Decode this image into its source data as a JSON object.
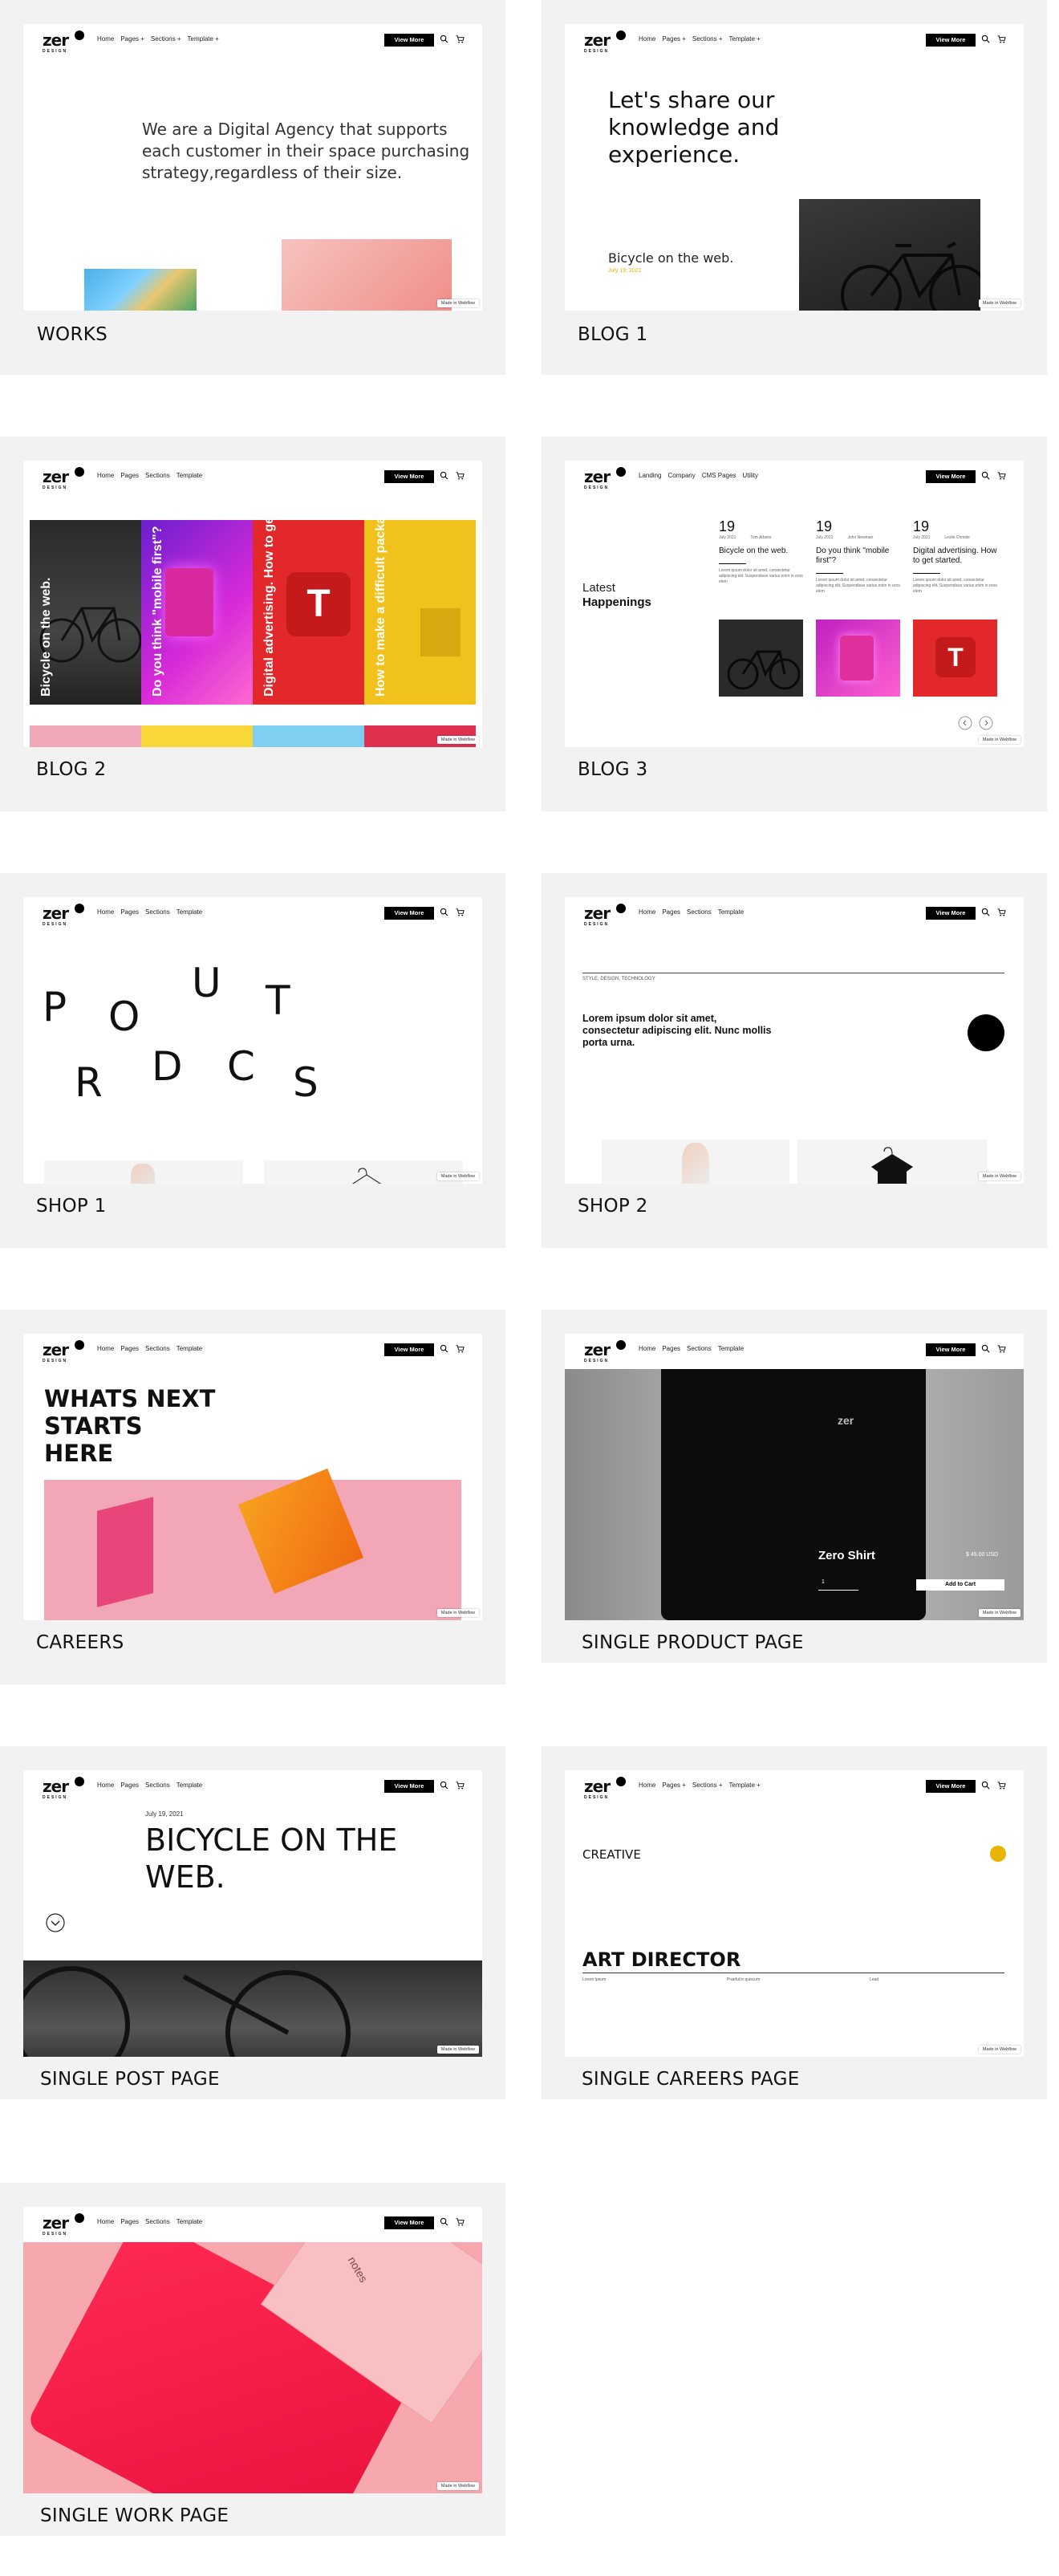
{
  "colors": {
    "card_bg": "#f2f2f2",
    "accent_yellow": "#e8b400",
    "brand_black": "#000000"
  },
  "nav": {
    "logo_text": "zer",
    "logo_sub": "DESIGN",
    "cta": "View More",
    "links_a": [
      "Home",
      "Pages +",
      "Sections +",
      "Template +"
    ],
    "links_b": [
      "Home",
      "Pages",
      "Sections",
      "Template"
    ],
    "links_c": [
      "Landing",
      "Company",
      "CMS Pages",
      "Utility"
    ],
    "links_d": [
      "Home",
      "Pages",
      "Sections +",
      "Template"
    ],
    "links_e": [
      "Home",
      "Pages +",
      "Sections +",
      "Template +"
    ],
    "search_icon": "search-icon",
    "cart_icon": "cart-icon"
  },
  "badge": "Made in Webflow",
  "cards": [
    {
      "label": "WORKS",
      "headline": "We are a Digital Agency that supports each customer in their space purchasing strategy,regardless of their size."
    },
    {
      "label": "BLOG 1",
      "headline": "Let's share our knowledge and experience.",
      "post_title": "Bicycle on the web.",
      "post_date": "July 19, 2021"
    },
    {
      "label": "BLOG 2",
      "tiles": [
        "Bicycle on the web.",
        "Do you think \"mobile first\"?",
        "Digital advertising. How to get started.",
        "How to make a difficult packaging."
      ]
    },
    {
      "label": "BLOG 3",
      "latest": "Latest",
      "happenings": "Happenings",
      "posts": [
        {
          "day": "19",
          "date": "July 2021",
          "author": "Tom Adams",
          "title": "Bicycle on the web.",
          "excerpt": "Lorem ipsum dolor sit amet, consectetur adipiscing elit. Suspendisse varius enim in eros elem"
        },
        {
          "day": "19",
          "date": "July 2021",
          "author": "John Newman",
          "title": "Do you think \"mobile first\"?",
          "excerpt": "Lorem ipsum dolor sit amet, consectetur adipiscing elit. Suspendisse varius enim in eros elem"
        },
        {
          "day": "19",
          "date": "July 2021",
          "author": "Leslie Christie",
          "title": "Digital advertising. How to get started.",
          "excerpt": "Lorem ipsum dolor sit amet, consectetur adipiscing elit. Suspendisse varius enim in eros elem"
        }
      ]
    },
    {
      "label": "SHOP 1",
      "letters": [
        "P",
        "O",
        "U",
        "T",
        "R",
        "D",
        "C",
        "S"
      ]
    },
    {
      "label": "SHOP 2",
      "tags": "STYLE, DESIGN, TECHNOLOGY",
      "text": "Lorem ipsum dolor sit amet, consectetur adipiscing elit. Nunc mollis porta urna."
    },
    {
      "label": "CAREERS",
      "headline_lines": [
        "WHATS NEXT",
        "STARTS",
        "HERE"
      ]
    },
    {
      "label": "SINGLE PRODUCT PAGE",
      "product": "Zero Shirt",
      "price": "$ 45.00 USD",
      "qty": "1",
      "add_to_cart": "Add to Cart"
    },
    {
      "label": "SINGLE POST PAGE",
      "date": "July 19, 2021",
      "title_lines": [
        "BICYCLE ON THE",
        "WEB."
      ]
    },
    {
      "label": "SINGLE CAREERS PAGE",
      "category": "CREATIVE",
      "title": "ART DIRECTOR",
      "meta": [
        "Lorem Ipsum",
        "Praeful in quiscum",
        "Lead"
      ]
    },
    {
      "label": "SINGLE WORK PAGE",
      "notes_text": "notes"
    }
  ]
}
